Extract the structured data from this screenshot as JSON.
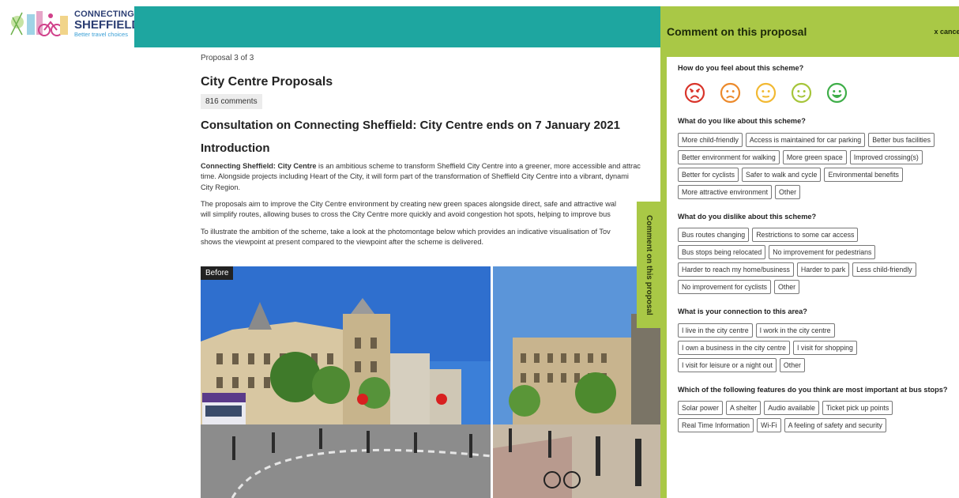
{
  "header": {
    "logo_line1": "CONNECTING",
    "logo_line2": "SHEFFIELD",
    "logo_tagline": "Better travel choices",
    "bar_color": "#1ea6a0"
  },
  "main": {
    "breadcrumb": "Proposal 3 of 3",
    "title": "City Centre Proposals",
    "comment_count": "816 comments",
    "consultation_heading": "Consultation on Connecting Sheffield: City Centre ends on 7 January 2021",
    "intro_heading": "Introduction",
    "p1_bold": "Connecting Sheffield: City Centre",
    "p1_line1_rest": " is an ambitious scheme to transform Sheffield City Centre into a greener, more accessible and attrac",
    "p1_line2": "time. Alongside projects including Heart of the City, it will form part of the transformation of Sheffield City Centre into a vibrant, dynami",
    "p1_line3": "City Region.",
    "p2_line1": "The proposals aim to improve the City Centre environment by creating new green spaces alongside direct, safe and attractive wal",
    "p2_line2": "will simplify routes, allowing buses to cross the City Centre more quickly and avoid congestion hot spots, helping to improve bus",
    "p3_line1": "To illustrate the ambition of the scheme, take a look at the photomontage below which provides an indicative visualisation of Tov",
    "p3_line2": "shows the viewpoint at present compared to the viewpoint after the scheme is delivered.",
    "before_label": "Before"
  },
  "side_tab": {
    "label": "Comment on this proposal"
  },
  "panel": {
    "title": "Comment on this proposal",
    "cancel": "x cancel",
    "accent": "#a9c846",
    "q_feel": "How do you feel about this scheme?",
    "faces": [
      {
        "name": "very-unhappy-face-icon",
        "color": "#d9352b"
      },
      {
        "name": "unhappy-face-icon",
        "color": "#ec8a2c"
      },
      {
        "name": "neutral-face-icon",
        "color": "#f2b933"
      },
      {
        "name": "happy-face-icon",
        "color": "#a6c53a"
      },
      {
        "name": "very-happy-face-icon",
        "color": "#3fae49"
      }
    ],
    "q_like": "What do you like about this scheme?",
    "like_options": [
      "More child-friendly",
      "Access is maintained for car parking",
      "Better bus facilities",
      "Better environment for walking",
      "More green space",
      "Improved crossing(s)",
      "Better for cyclists",
      "Safer to walk and cycle",
      "Environmental benefits",
      "More attractive environment",
      "Other"
    ],
    "q_dislike": "What do you dislike about this scheme?",
    "dislike_options": [
      "Bus routes changing",
      "Restrictions to some car access",
      "Bus stops being relocated",
      "No improvement for pedestrians",
      "Harder to reach my home/business",
      "Harder to park",
      "Less child-friendly",
      "No improvement for cyclists",
      "Other"
    ],
    "q_connection": "What is your connection to this area?",
    "connection_options": [
      "I live in the city centre",
      "I work in the city centre",
      "I own a business in the city centre",
      "I visit for shopping",
      "I visit for leisure or a night out",
      "Other"
    ],
    "q_busstops": "Which of the following features do you think are most important at bus stops?",
    "busstop_options": [
      "Solar power",
      "A shelter",
      "Audio available",
      "Ticket pick up points",
      "Real Time Information",
      "Wi-Fi",
      "A feeling of safety and security"
    ]
  }
}
